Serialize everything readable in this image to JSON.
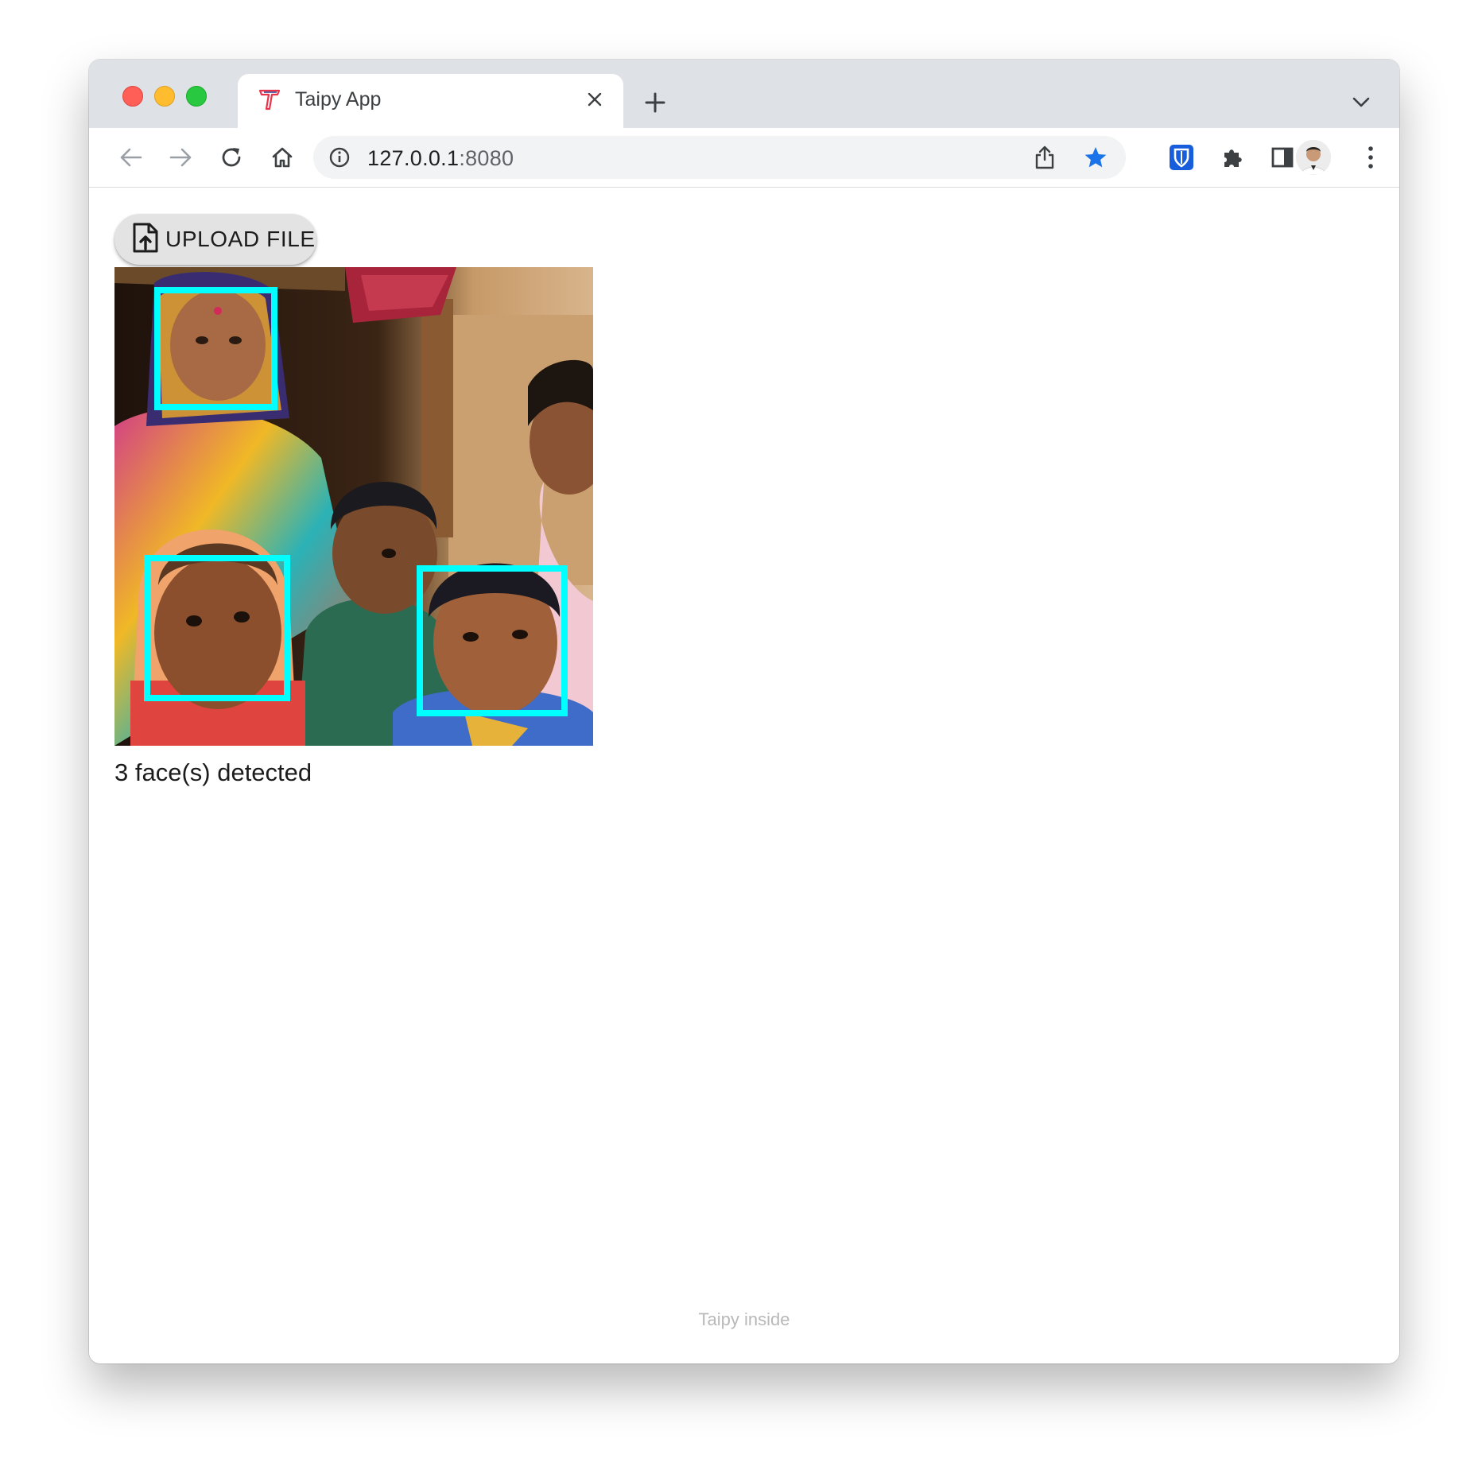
{
  "browser": {
    "tab_title": "Taipy App",
    "url_host": "127.0.0.1",
    "url_port": ":8080",
    "accent_color": "#1a73e8"
  },
  "icons": {
    "favicon": "taipy-logo-icon",
    "tab_close": "close-icon",
    "new_tab": "plus-icon",
    "tab_search": "chevron-down-icon",
    "back": "arrow-left-icon",
    "forward": "arrow-right-icon",
    "reload": "reload-icon",
    "home": "home-icon",
    "site_info": "info-icon",
    "share": "share-icon",
    "bookmark": "star-icon",
    "bitwarden": "shield-icon",
    "extensions": "puzzle-icon",
    "side_panel": "side-panel-icon",
    "menu": "kebab-menu-icon",
    "upload": "file-upload-icon"
  },
  "app": {
    "upload_label": "UPLOAD FILE",
    "result_text": "3 face(s) detected",
    "box_color": "#00ffff",
    "footer": "Taipy inside"
  }
}
